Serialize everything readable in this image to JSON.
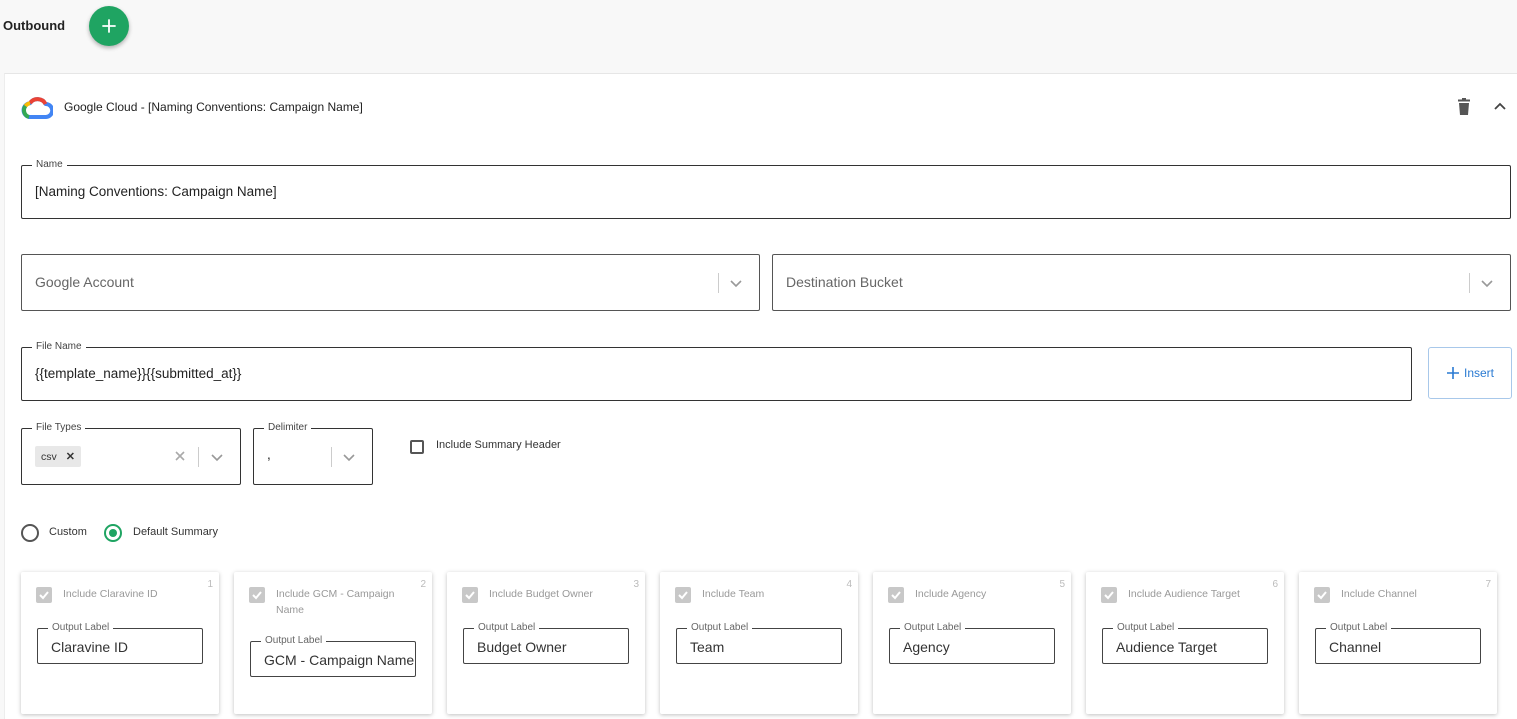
{
  "header": {
    "title": "Outbound"
  },
  "destination": {
    "title": "Google Cloud - [Naming Conventions: Campaign Name]",
    "fields": {
      "name": {
        "label": "Name",
        "value": "[Naming Conventions: Campaign Name]"
      },
      "google_account": {
        "placeholder": "Google Account"
      },
      "destination_bucket": {
        "placeholder": "Destination Bucket"
      },
      "file_name": {
        "label": "File Name",
        "value": "{{template_name}}{{submitted_at}}"
      },
      "insert_label": "Insert",
      "file_types": {
        "label": "File Types",
        "chip": "csv"
      },
      "delimiter": {
        "label": "Delimiter",
        "value": ","
      },
      "include_summary_header": {
        "label": "Include Summary Header",
        "checked": false
      }
    },
    "summary_mode": {
      "options": [
        "Custom",
        "Default Summary"
      ],
      "selected": "Default Summary"
    },
    "summary_items": [
      {
        "number": "1",
        "label": "Include Claravine ID",
        "output_label_caption": "Output Label",
        "output_value": "Claravine ID"
      },
      {
        "number": "2",
        "label": "Include GCM - Campaign Name",
        "output_label_caption": "Output Label",
        "output_value": "GCM - Campaign Name"
      },
      {
        "number": "3",
        "label": "Include Budget Owner",
        "output_label_caption": "Output Label",
        "output_value": "Budget Owner"
      },
      {
        "number": "4",
        "label": "Include Team",
        "output_label_caption": "Output Label",
        "output_value": "Team"
      },
      {
        "number": "5",
        "label": "Include Agency",
        "output_label_caption": "Output Label",
        "output_value": "Agency"
      },
      {
        "number": "6",
        "label": "Include Audience Target",
        "output_label_caption": "Output Label",
        "output_value": "Audience Target"
      },
      {
        "number": "7",
        "label": "Include Channel",
        "output_label_caption": "Output Label",
        "output_value": "Channel"
      }
    ]
  },
  "colors": {
    "accent_green": "#1fa462",
    "insert_blue": "#2a7ad2"
  },
  "icons": [
    "plus-icon",
    "google-cloud-logo",
    "trash-icon",
    "chevron-up-icon",
    "chevron-down-icon",
    "close-icon",
    "check-icon"
  ]
}
